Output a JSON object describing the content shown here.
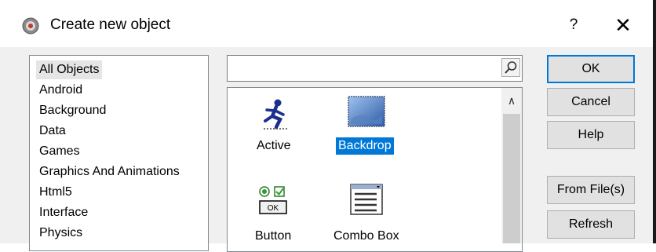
{
  "window": {
    "title": "Create new object",
    "help_label": "?",
    "close_label": "✕"
  },
  "categories": [
    {
      "label": "All Objects",
      "selected": true
    },
    {
      "label": "Android"
    },
    {
      "label": "Background"
    },
    {
      "label": "Data"
    },
    {
      "label": "Games"
    },
    {
      "label": "Graphics And Animations"
    },
    {
      "label": "Html5"
    },
    {
      "label": "Interface"
    },
    {
      "label": "Physics"
    }
  ],
  "search": {
    "value": "",
    "placeholder": ""
  },
  "objects": [
    {
      "label": "Active",
      "icon": "running-man-icon"
    },
    {
      "label": "Backdrop",
      "icon": "backdrop-icon",
      "selected": true
    },
    {
      "label": "Button",
      "icon": "button-control-icon"
    },
    {
      "label": "Combo Box",
      "icon": "combo-box-icon"
    }
  ],
  "buttons": {
    "ok": "OK",
    "cancel": "Cancel",
    "help": "Help",
    "from_files": "From File(s)",
    "refresh": "Refresh"
  },
  "colors": {
    "selection": "#0078d7",
    "default_border": "#0078d7"
  }
}
